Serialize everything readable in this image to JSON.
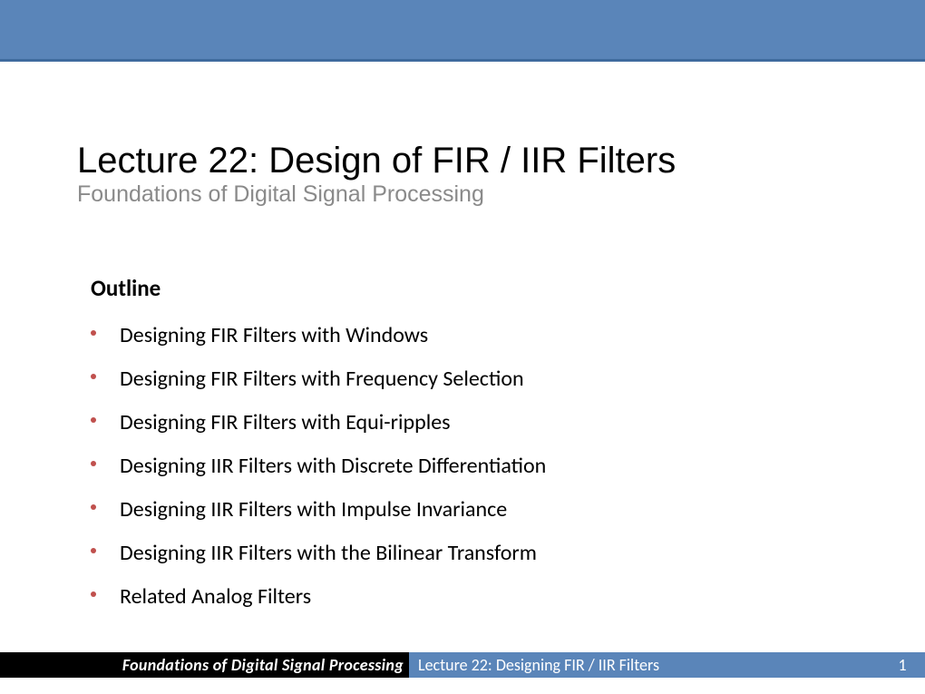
{
  "title": "Lecture  22: Design of FIR / IIR Filters",
  "subtitle": "Foundations of Digital Signal Processing",
  "outline": {
    "heading": "Outline",
    "items": [
      "Designing FIR Filters with Windows",
      "Designing FIR Filters with Frequency Selection",
      "Designing FIR Filters with Equi-ripples",
      "Designing IIR Filters with Discrete Differentiation",
      "Designing IIR Filters with Impulse Invariance",
      "Designing IIR Filters with the Bilinear Transform",
      "Related Analog Filters"
    ]
  },
  "footer": {
    "course": "Foundations of Digital Signal Processing",
    "lecture": "Lecture 22: Designing FIR / IIR Filters",
    "page": "1"
  }
}
